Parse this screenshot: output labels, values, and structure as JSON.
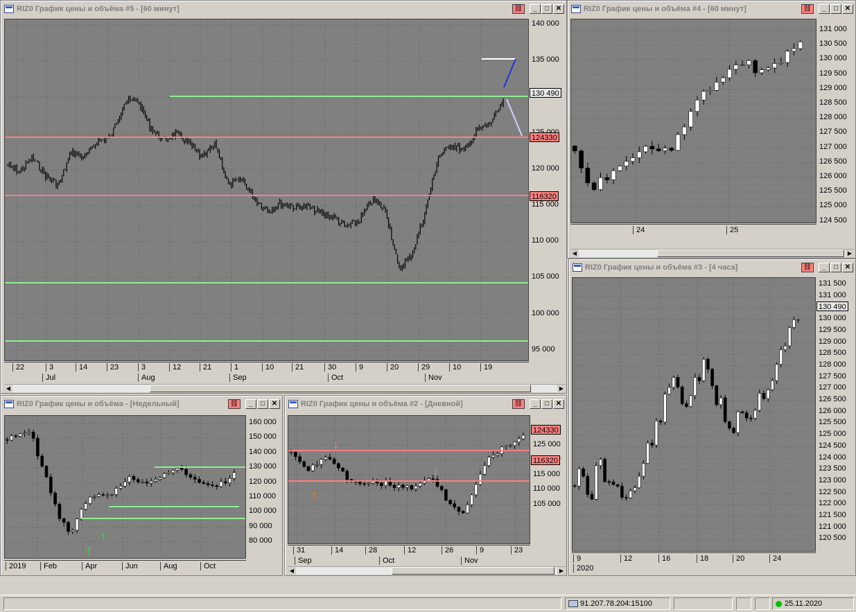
{
  "windows": {
    "w5": {
      "title": "RIZ0 График цены и объёма #5 - [60 минут]",
      "yticks": [
        "140 000",
        "135 000",
        "130 000",
        "125 000",
        "120 000",
        "115 000",
        "110 000",
        "105 000",
        "100 000",
        "95 000"
      ],
      "price_tags": [
        "130 490",
        "124330",
        "116320"
      ],
      "xticks": [
        "22",
        "3",
        "14",
        "23",
        "3",
        "12",
        "21",
        "1",
        "10",
        "21",
        "30",
        "9",
        "20",
        "29",
        "10",
        "19"
      ],
      "months": [
        "Jul",
        "Aug",
        "Sep",
        "Oct",
        "Nov"
      ]
    },
    "w4": {
      "title": "RIZ0 График цены и объёма #4 - [60 минут]",
      "yticks": [
        "131 000",
        "130 500",
        "130 000",
        "129 500",
        "129 000",
        "128 500",
        "128 000",
        "127 500",
        "127 000",
        "126 500",
        "126 000",
        "125 500",
        "125 000",
        "124 500"
      ],
      "xticks": [
        "24",
        "25"
      ]
    },
    "w3": {
      "title": "RIZ0 График цены и объёма #3 - [4 часа]",
      "yticks": [
        "131 500",
        "131 000",
        "130 500",
        "130 000",
        "129 500",
        "129 000",
        "128 500",
        "128 000",
        "127 500",
        "127 000",
        "126 500",
        "126 000",
        "125 500",
        "125 000",
        "124 500",
        "124 000",
        "123 500",
        "123 000",
        "122 500",
        "122 000",
        "121 500",
        "121 000",
        "120 500"
      ],
      "price_tag": "130 490",
      "xticks": [
        "9",
        "12",
        "16",
        "18",
        "20",
        "24"
      ],
      "year": "2020"
    },
    "w1": {
      "title": "RIZ0 График цены и объёма - [Недельный]",
      "yticks": [
        "160 000",
        "150 000",
        "140 000",
        "130 000",
        "120 000",
        "110 000",
        "100 000",
        "90 000",
        "80 000"
      ],
      "xticks": [
        "2019",
        "Feb",
        "Apr",
        "Jun",
        "Aug",
        "Oct"
      ]
    },
    "w2": {
      "title": "RIZ0 График цены и объёма #2 - [Дневной]",
      "yticks": [
        "130 000",
        "125 000",
        "120 000",
        "115 000",
        "110 000",
        "105 000"
      ],
      "price_tags": [
        "124330",
        "116320"
      ],
      "xticks": [
        "31",
        "14",
        "28",
        "12",
        "26",
        "9",
        "23"
      ],
      "months": [
        "Sep",
        "Oct",
        "Nov"
      ]
    }
  },
  "status": {
    "server": "91.207.78.204:15100",
    "date": "25.11.2020"
  },
  "colors": {
    "chart_bg": "#808080",
    "support_green": "#90ee90",
    "level_pink": "#ff8080",
    "status_green": "#00c000"
  }
}
